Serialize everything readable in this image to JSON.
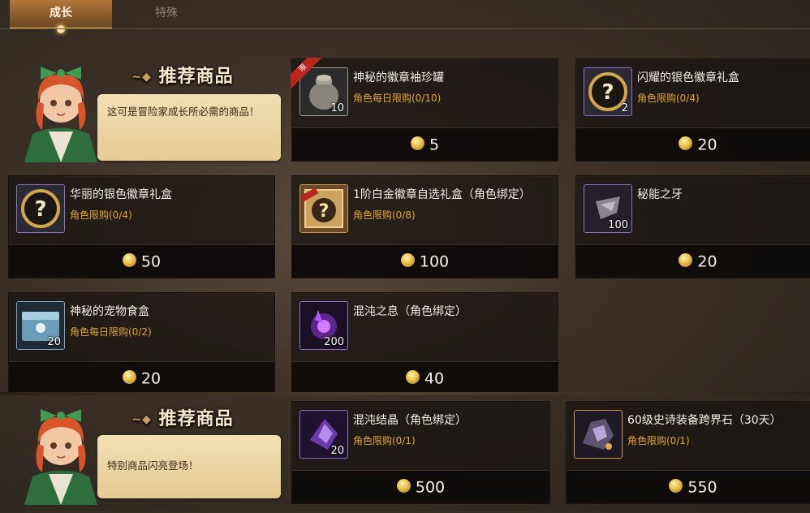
{
  "tabs": [
    {
      "label": "成长",
      "active": true
    },
    {
      "label": "特殊",
      "active": false
    }
  ],
  "sections": [
    {
      "title": "推荐商品",
      "speech": "这可是冒险家成长所必需的商品！",
      "items": [
        {
          "name": "神秘的徽章袖珍罐",
          "limit": "角色每日限购(0/10)",
          "qty": "10",
          "price": "5",
          "icon": "jar-icon",
          "tag": "限"
        },
        {
          "name": "闪耀的银色徽章礼盒",
          "limit": "角色限购(0/4)",
          "qty": "2",
          "price": "20",
          "icon": "mystery-box-icon"
        },
        {
          "name": "华丽的银色徽章礼盒",
          "limit": "角色限购(0/4)",
          "qty": "",
          "price": "50",
          "icon": "mystery-box-icon"
        },
        {
          "name": "1阶白金徽章自选礼盒（角色绑定）",
          "limit": "角色限购(0/8)",
          "qty": "",
          "price": "100",
          "icon": "platinum-box-icon"
        },
        {
          "name": "秘能之牙",
          "limit": "",
          "qty": "100",
          "price": "20",
          "icon": "fang-icon"
        },
        {
          "name": "神秘的宠物食盒",
          "limit": "角色每日限购(0/2)",
          "qty": "20",
          "price": "20",
          "icon": "pet-food-box-icon"
        },
        {
          "name": "混沌之息（角色绑定）",
          "limit": "",
          "qty": "200",
          "price": "40",
          "icon": "chaos-breath-icon"
        }
      ]
    },
    {
      "title": "推荐商品",
      "speech": "特别商品闪亮登场！",
      "items": [
        {
          "name": "混沌结晶（角色绑定）",
          "limit": "角色限购(0/1)",
          "qty": "20",
          "price": "500",
          "icon": "chaos-crystal-icon"
        },
        {
          "name": "60级史诗装备跨界石（30天）",
          "limit": "角色限购(0/1)",
          "qty": "",
          "price": "550",
          "icon": "epic-stone-icon"
        }
      ]
    }
  ]
}
